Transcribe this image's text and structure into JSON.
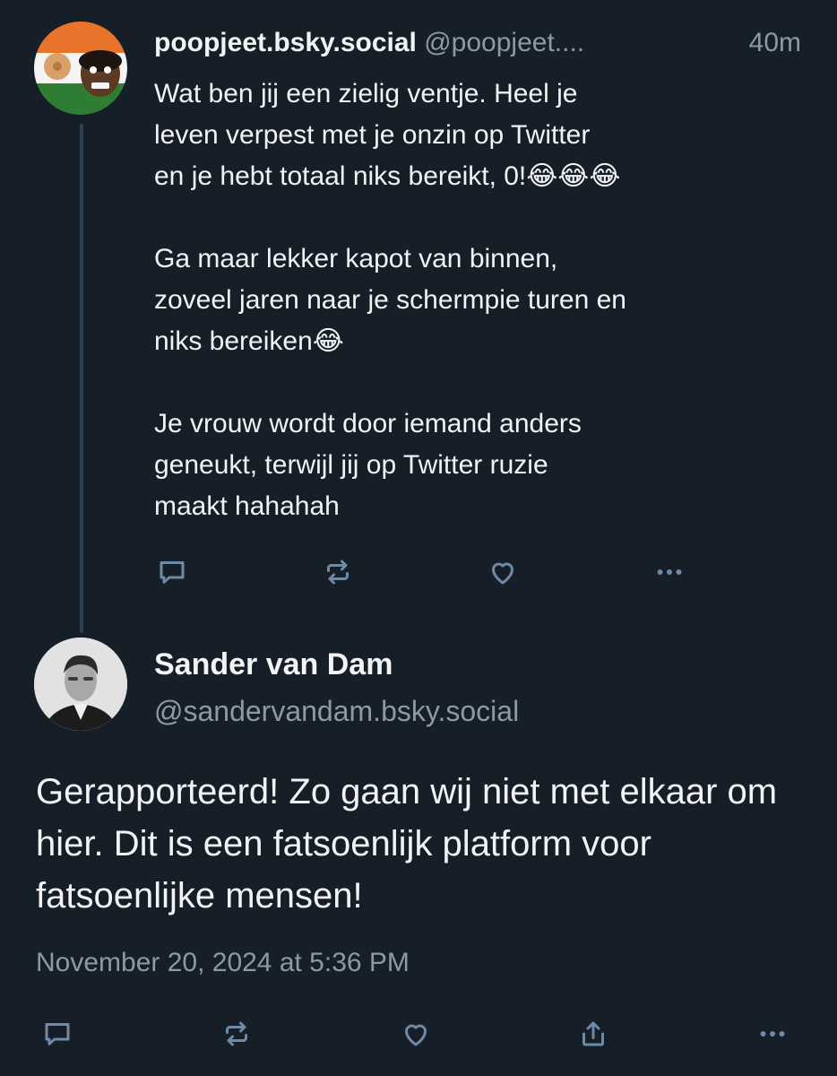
{
  "reply": {
    "display_name": "poopjeet.bsky.social",
    "handle": "@poopjeet....",
    "time_ago": "40m",
    "paragraphs": [
      "Wat ben jij een zielig ventje. Heel je\nleven verpest met je onzin op Twitter\nen je hebt totaal niks bereikt, 0!😂😂😂",
      "Ga maar lekker kapot van binnen,\nzoveel jaren naar je schermpie turen en\nniks bereiken😂",
      "Je vrouw wordt door iemand anders\ngeneukt, terwijl jij op Twitter ruzie\nmaakt hahahah"
    ]
  },
  "main_post": {
    "display_name": "Sander van Dam",
    "handle": "@sandervandam.bsky.social",
    "text": "Gerapporteerd! Zo gaan wij niet met elkaar om hier. Dit is een fatsoenlijk platform voor fatsoenlijke mensen!",
    "timestamp": "November 20, 2024 at 5:36 PM"
  },
  "colors": {
    "background": "#161e27",
    "text_primary": "#f1f3f5",
    "text_secondary": "#8c9aa8",
    "icon": "#6e8aa6",
    "thread_line": "#2e4052"
  },
  "icons": {
    "reply_actions": [
      "reply-icon",
      "repost-icon",
      "like-icon",
      "more-icon"
    ],
    "post_actions": [
      "reply-icon",
      "repost-icon",
      "like-icon",
      "share-icon",
      "more-icon"
    ]
  }
}
